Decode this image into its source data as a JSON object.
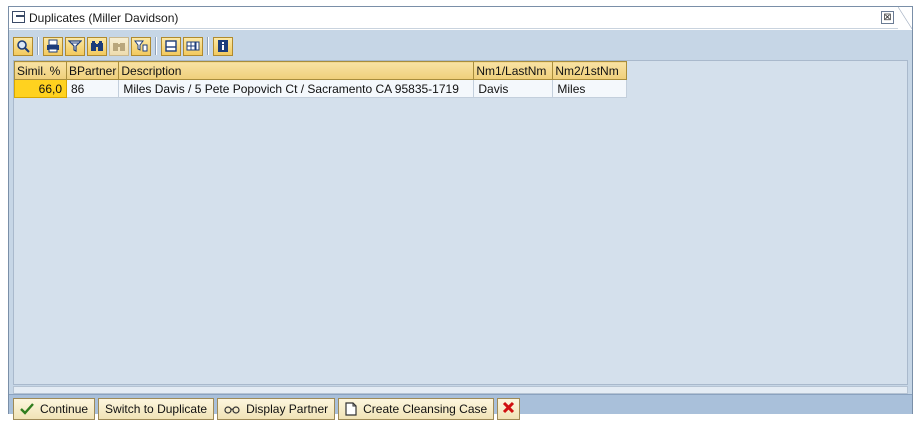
{
  "window": {
    "title": "Duplicates  (Miller Davidson)",
    "close_glyph": "⊠"
  },
  "toolbar": {
    "buttons": [
      {
        "icon": "find-icon"
      },
      {
        "icon": "print-icon"
      },
      {
        "icon": "filter-icon"
      },
      {
        "icon": "binoculars-icon"
      },
      {
        "icon": "find-next-icon"
      },
      {
        "icon": "set-filter-icon"
      },
      {
        "icon": "print-preview-icon"
      },
      {
        "icon": "layout-icon"
      },
      {
        "icon": "info-icon"
      }
    ]
  },
  "grid": {
    "columns": [
      "Simil. %",
      "BPartner",
      "Description",
      "Nm1/LastNm",
      "Nm2/1stNm"
    ],
    "rows": [
      {
        "simil": "66,0",
        "bpartner": "86",
        "description": "Miles Davis / 5 Pete Popovich Ct / Sacramento CA 95835-1719",
        "name1": "Davis",
        "name2": "Miles"
      }
    ]
  },
  "footer": {
    "continue": "Continue",
    "switch": "Switch to Duplicate",
    "display": "Display Partner",
    "cleansing": "Create Cleansing Case"
  },
  "colors": {
    "accent": "#ffd21f",
    "background": "#c6d6e6"
  }
}
